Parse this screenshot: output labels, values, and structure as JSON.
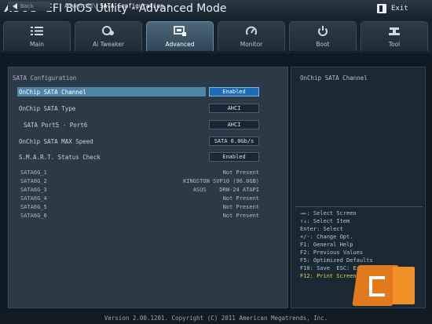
{
  "header": {
    "logo": "ASUS",
    "title": "EFI BIOS Utility - Advanced Mode",
    "exit_label": "Exit",
    "exit_icon": "exit-door-icon"
  },
  "tabs": [
    {
      "label": "Main",
      "icon": "list-icon",
      "active": false
    },
    {
      "label": "Ai Tweaker",
      "icon": "tweaker-icon",
      "active": false
    },
    {
      "label": "Advanced",
      "icon": "advanced-icon",
      "active": true
    },
    {
      "label": "Monitor",
      "icon": "monitor-icon",
      "active": false
    },
    {
      "label": "Boot",
      "icon": "power-icon",
      "active": false
    },
    {
      "label": "Tool",
      "icon": "tool-icon",
      "active": false
    }
  ],
  "nav": {
    "back_label": "Back",
    "breadcrumb_parent": "Advanced\\",
    "breadcrumb_current": "SATA Configuration >"
  },
  "main": {
    "section_title": "SATA Configuration",
    "settings": [
      {
        "label": "OnChip SATA Channel",
        "value": "Enabled",
        "selected": true
      },
      {
        "label": "OnChip SATA Type",
        "value": "AHCI",
        "selected": false
      },
      {
        "label": "SATA Port5 - Port6",
        "value": "AHCI",
        "selected": false
      },
      {
        "label": "OnChip SATA MAX Speed",
        "value": "SATA 6.0Gb/s",
        "selected": false
      },
      {
        "label": "S.M.A.R.T. Status Check",
        "value": "Enabled",
        "selected": false
      }
    ],
    "devices": [
      {
        "label": "SATA6G_1",
        "value": "Not Present"
      },
      {
        "label": "SATA6G_2",
        "value": "KINGSTON SVP10 (96.0GB)"
      },
      {
        "label": "SATA6G_3",
        "value": "ASUS    DRW-24 ATAPI"
      },
      {
        "label": "SATA6G_4",
        "value": "Not Present"
      },
      {
        "label": "SATA6G_5",
        "value": "Not Present"
      },
      {
        "label": "SATA6G_6",
        "value": "Not Present"
      }
    ]
  },
  "help": {
    "text": "OnChip SATA Channel",
    "keys": [
      "→←: Select Screen",
      "↑↓: Select Item",
      "Enter: Select",
      "+/-: Change Opt.",
      "F1: General Help",
      "F2: Previous Values",
      "F5: Optimized Defaults",
      "F10: Save  ESC: Exit",
      "F12: Print Screen"
    ]
  },
  "footer": {
    "copyright": "Version 2.00.1201. Copyright (C) 2011 American Megatrends, Inc."
  },
  "colors": {
    "highlight": "#4e86a8",
    "selected_value": "#1d6bb4",
    "hotkey_yellow": "#e3d34a",
    "active_tab": "#4f6878"
  }
}
